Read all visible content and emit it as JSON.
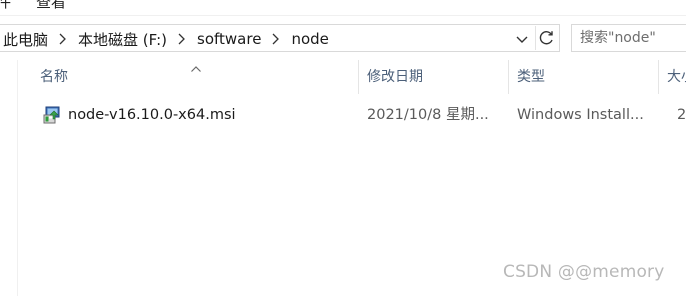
{
  "ribbon": {
    "left_item": "件",
    "view_tab": "查看"
  },
  "address_bar": {
    "crumbs": [
      "此电脑",
      "本地磁盘 (F:)",
      "software",
      "node"
    ]
  },
  "search": {
    "placeholder": "搜索\"node\""
  },
  "columns": {
    "name": "名称",
    "modified": "修改日期",
    "type": "类型",
    "size": "大小"
  },
  "files": [
    {
      "name": "node-v16.10.0-x64.msi",
      "modified": "2021/10/8 星期...",
      "type": "Windows Install...",
      "size": "2"
    }
  ],
  "icons": {
    "crumb_separator": "chevron-right-icon",
    "address_dropdown": "chevron-down-icon",
    "refresh": "refresh-icon",
    "sort": "sort-up-icon",
    "file": "msi-installer-icon"
  },
  "watermark": "CSDN @@memory"
}
